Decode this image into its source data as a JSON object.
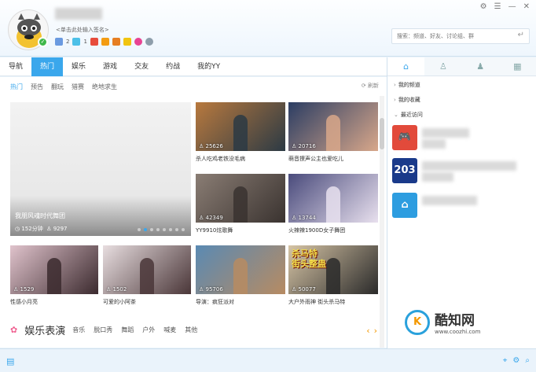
{
  "header": {
    "signature_placeholder": "<单击此处输入签名>",
    "badge_counts": [
      "2",
      "1"
    ],
    "window_controls": [
      "⚙",
      "☰",
      "—",
      "✕"
    ],
    "search": {
      "placeholder": "搜索：频道、好友、讨论组、群",
      "enter_icon": "enter-icon"
    }
  },
  "main_tabs": [
    {
      "label": "导航",
      "active": false
    },
    {
      "label": "热门",
      "active": true
    },
    {
      "label": "娱乐",
      "active": false
    },
    {
      "label": "游戏",
      "active": false
    },
    {
      "label": "交友",
      "active": false
    },
    {
      "label": "约战",
      "active": false
    },
    {
      "label": "我的YY",
      "active": false
    }
  ],
  "sub_tabs": [
    {
      "label": "热门",
      "active": true
    },
    {
      "label": "预告",
      "active": false
    },
    {
      "label": "翻玩",
      "active": false
    },
    {
      "label": "猎赛",
      "active": false
    },
    {
      "label": "绝地求生",
      "active": false
    }
  ],
  "refresh_label": "刷新",
  "banner": {
    "title": "我朋风魂时代舞团",
    "duration": "152分钟",
    "viewers": "9297"
  },
  "cards": [
    {
      "count": "25626",
      "caption": "杀人吃鸡老铁没毛病",
      "bg": "#b8793e",
      "accent": "#2c3a44"
    },
    {
      "count": "20716",
      "caption": "萌音撩声公主也爱吃儿",
      "bg": "#2b3d63",
      "accent": "#d8a78a"
    },
    {
      "count": "42349",
      "caption": "YY9910炫歌舞",
      "bg": "#8a7d74",
      "accent": "#3a3330"
    },
    {
      "count": "13744",
      "caption": "火辣辣1900D女子舞团",
      "bg": "#4a4b7c",
      "accent": "#e8e0ee"
    },
    {
      "count": "1529",
      "caption": "性感小月亮",
      "bg": "#e0c3cc",
      "accent": "#3b2a2e"
    },
    {
      "count": "1502",
      "caption": "可爱的小阿茶",
      "bg": "#e8dee0",
      "accent": "#4a3638"
    },
    {
      "count": "95706",
      "caption": "导演：疯狂派对",
      "bg": "#5a8ab3",
      "accent": "#b78b62"
    },
    {
      "count": "50077",
      "caption": "大户外雨神 街头杀马特",
      "bg": "#d6c4a5",
      "accent": "#2a2a2a"
    }
  ],
  "banner_overlay_text": [
    "杀马特",
    "街头整蛊"
  ],
  "section": {
    "title": "娱乐表演",
    "tags": [
      "音乐",
      "脱口秀",
      "舞蹈",
      "户外",
      "喊麦",
      "其他"
    ]
  },
  "right_panel": {
    "tabs": [
      "home-icon",
      "contact-icon",
      "group-icon",
      "apps-icon"
    ],
    "items": [
      {
        "label": "我的频道",
        "arrow": "›"
      },
      {
        "label": "我的收藏",
        "arrow": "›"
      },
      {
        "label": "最近访问",
        "arrow": "⌄"
      }
    ],
    "recent": [
      {
        "color": "#e24a3b",
        "icon": "gamepad-icon",
        "glyph": "🎮"
      },
      {
        "color": "#1a3a8a",
        "icon": "channel-logo-icon",
        "glyph": "203"
      },
      {
        "color": "#2d9de0",
        "icon": "home-icon",
        "glyph": "⌂"
      }
    ]
  },
  "watermark": {
    "logo_letter": "K",
    "name": "酷知网",
    "url": "www.coozhi.com"
  },
  "footer": {
    "left_icon": "clipboard-icon",
    "right_icons": [
      "location-icon",
      "settings-icon",
      "search-icon"
    ]
  }
}
